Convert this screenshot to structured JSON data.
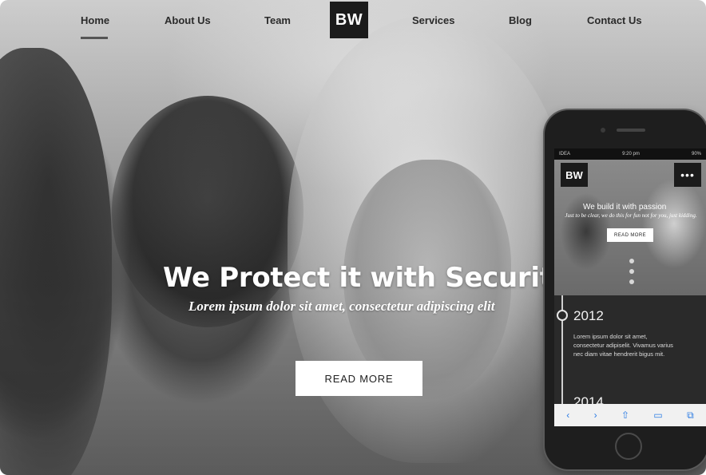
{
  "nav": {
    "items": [
      {
        "label": "Home",
        "active": true
      },
      {
        "label": "About Us"
      },
      {
        "label": "Team"
      },
      {
        "label": "Services"
      },
      {
        "label": "Blog"
      },
      {
        "label": "Contact Us"
      }
    ],
    "logo": "BW"
  },
  "hero": {
    "title": "We Protect it with Security",
    "subtitle": "Lorem ipsum dolor sit amet, consectetur adipiscing elit",
    "button_label": "READ MORE"
  },
  "phone": {
    "status_left": "IDEA",
    "status_time": "9:20 pm",
    "status_right": "90%",
    "logo": "BW",
    "menu_icon": "•••",
    "title": "We build it with passion",
    "subtitle": "Just to be clear, we do this for fun not for you, just kidding.",
    "button_label": "READ MORE",
    "timeline": {
      "year": "2012",
      "text": "Lorem ipsum dolor sit amet, consectetur adipiselit. Vivamus varius nec diam vitae hendrerit bigus mit.",
      "next_year": "2014"
    },
    "toolbar_icons": [
      "back-icon",
      "forward-icon",
      "share-icon",
      "bookmarks-icon",
      "tabs-icon"
    ]
  },
  "colors": {
    "logo_bg": "#1b1b1b",
    "button_bg": "#ffffff",
    "toolbar_accent": "#2a7be4"
  }
}
